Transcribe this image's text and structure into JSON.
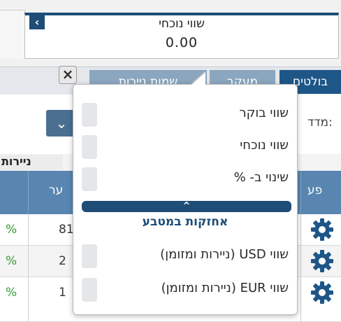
{
  "value_panel": {
    "label": "שווי נוכחי",
    "value": "0.00",
    "collapse_glyph": "‹"
  },
  "tabs": [
    {
      "label": "בולטים",
      "state": "active"
    },
    {
      "label": "מעקב",
      "state": "inactive"
    },
    {
      "label": "שמות ניירות",
      "state": "inactive"
    }
  ],
  "close_glyph": "×",
  "filter": {
    "index_label": "מדד:",
    "dropdown_glyph": "⌄"
  },
  "section_title": "ניירות",
  "table": {
    "headers": [
      "ער",
      "פע"
    ],
    "rows": [
      {
        "pct": "%",
        "num": "81"
      },
      {
        "pct": "%",
        "num": "2"
      },
      {
        "pct": "%",
        "num": "1"
      }
    ]
  },
  "popover": {
    "options_top": [
      "שווי בוקר",
      "שווי נוכחי",
      "שינוי ב- %"
    ],
    "collapse_glyph": "^",
    "group_title": "אחזקות במטבע",
    "options_bottom": [
      "שווי USD (ניירות ומזומן)",
      "שווי EUR (ניירות ומזומן)"
    ]
  },
  "colors": {
    "primary": "#1e4d77",
    "tab_active": "#1e5687",
    "tab_inactive": "#8ba6bf",
    "table_header": "#5886b0",
    "positive": "#2d9e2d"
  },
  "icons": {
    "gear": "gear-icon",
    "close": "close-icon",
    "chevron": "chevron-down-icon"
  }
}
